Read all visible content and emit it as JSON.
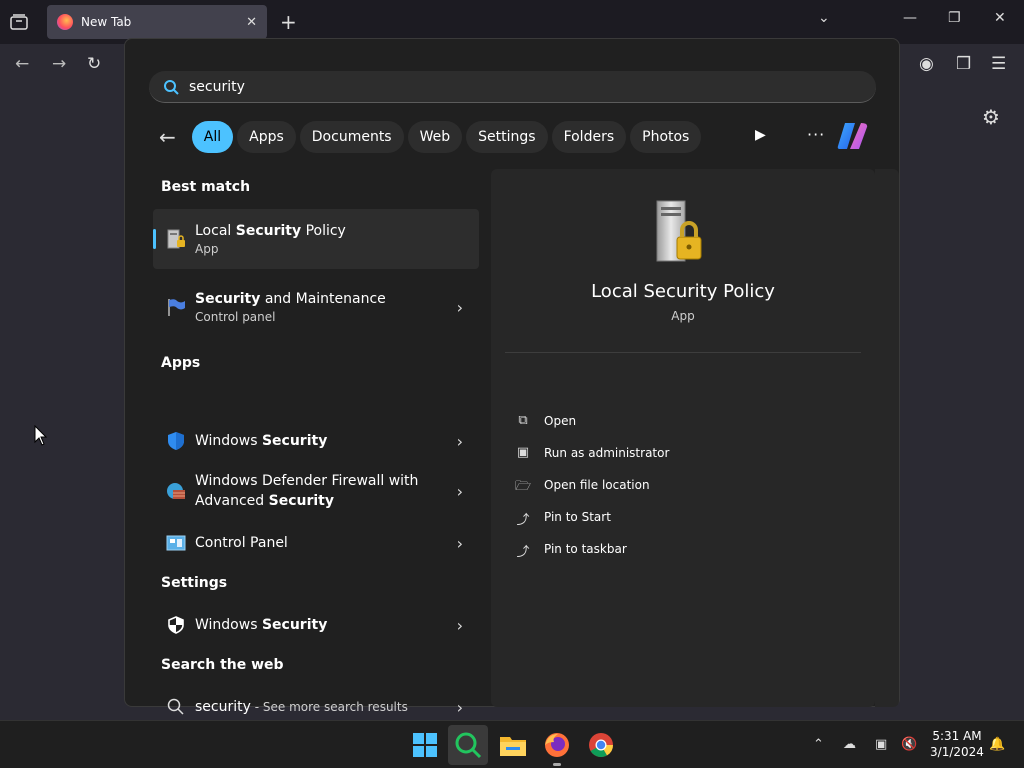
{
  "browser": {
    "tab_title": "New Tab",
    "new_tab": "+",
    "close_tab": "✕"
  },
  "search": {
    "query": "security",
    "filters": [
      "All",
      "Apps",
      "Documents",
      "Web",
      "Settings",
      "Folders",
      "Photos"
    ],
    "active_filter": "All"
  },
  "results": {
    "best_match_header": "Best match",
    "best_match": {
      "pre": "Local ",
      "bold": "Security",
      "post": " Policy",
      "sub": "App"
    },
    "security_maintenance": {
      "pre": "",
      "bold": "Security",
      "post": " and Maintenance",
      "sub": "Control panel"
    },
    "apps_header": "Apps",
    "apps": [
      {
        "pre": "Windows ",
        "bold": "Security",
        "post": ""
      },
      {
        "pre": "Windows Defender Firewall with",
        "pre2": "Advanced ",
        "bold": "Security",
        "post": ""
      },
      {
        "pre": "Control Panel",
        "bold": "",
        "post": ""
      }
    ],
    "settings_header": "Settings",
    "settings_item": {
      "pre": "Windows ",
      "bold": "Security",
      "post": ""
    },
    "web_header": "Search the web",
    "web_item": {
      "query": "security",
      "suffix": " - See more search results"
    }
  },
  "detail": {
    "title": "Local Security Policy",
    "subtitle": "App",
    "actions": [
      "Open",
      "Run as administrator",
      "Open file location",
      "Pin to Start",
      "Pin to taskbar"
    ]
  },
  "taskbar": {
    "time": "5:31 AM",
    "date": "3/1/2024"
  },
  "colors": {
    "accent": "#4cc2ff",
    "panel_bg": "#202020"
  }
}
